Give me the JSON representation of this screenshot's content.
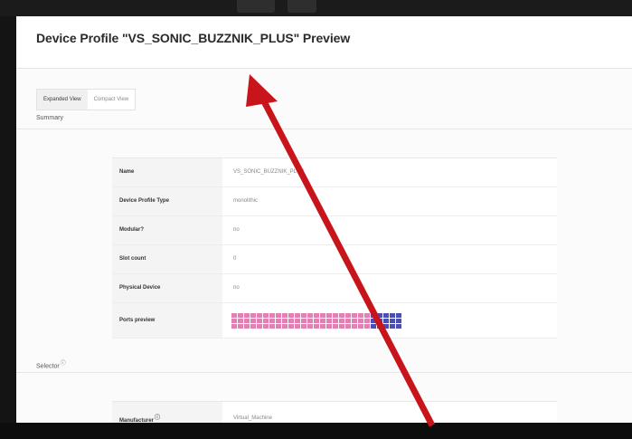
{
  "modal": {
    "title": "Device Profile \"VS_SONIC_BUZZNIK_PLUS\" Preview"
  },
  "tabs": [
    {
      "label": "Expanded View",
      "active": true
    },
    {
      "label": "Compact View",
      "active": false
    }
  ],
  "summary": {
    "label": "Summary",
    "rows": [
      {
        "key": "Name",
        "value": "VS_SONIC_BUZZNIK_PLUS"
      },
      {
        "key": "Device Profile Type",
        "value": "monolithic"
      },
      {
        "key": "Modular?",
        "value": "no"
      },
      {
        "key": "Slot count",
        "value": "0"
      },
      {
        "key": "Physical Device",
        "value": "no"
      },
      {
        "key": "Ports preview",
        "value": ""
      }
    ],
    "ports_preview": {
      "groups": [
        {
          "color": "#e27fb3",
          "columns": 22
        },
        {
          "color": "#4a4fb0",
          "columns": 5
        }
      ]
    }
  },
  "selector": {
    "label": "Selector",
    "info_icon": "info-icon",
    "rows": [
      {
        "key": "Manufacturer",
        "value": "Virtual_Machine"
      }
    ]
  },
  "annotation": {
    "arrow_color": "#c8141b"
  }
}
